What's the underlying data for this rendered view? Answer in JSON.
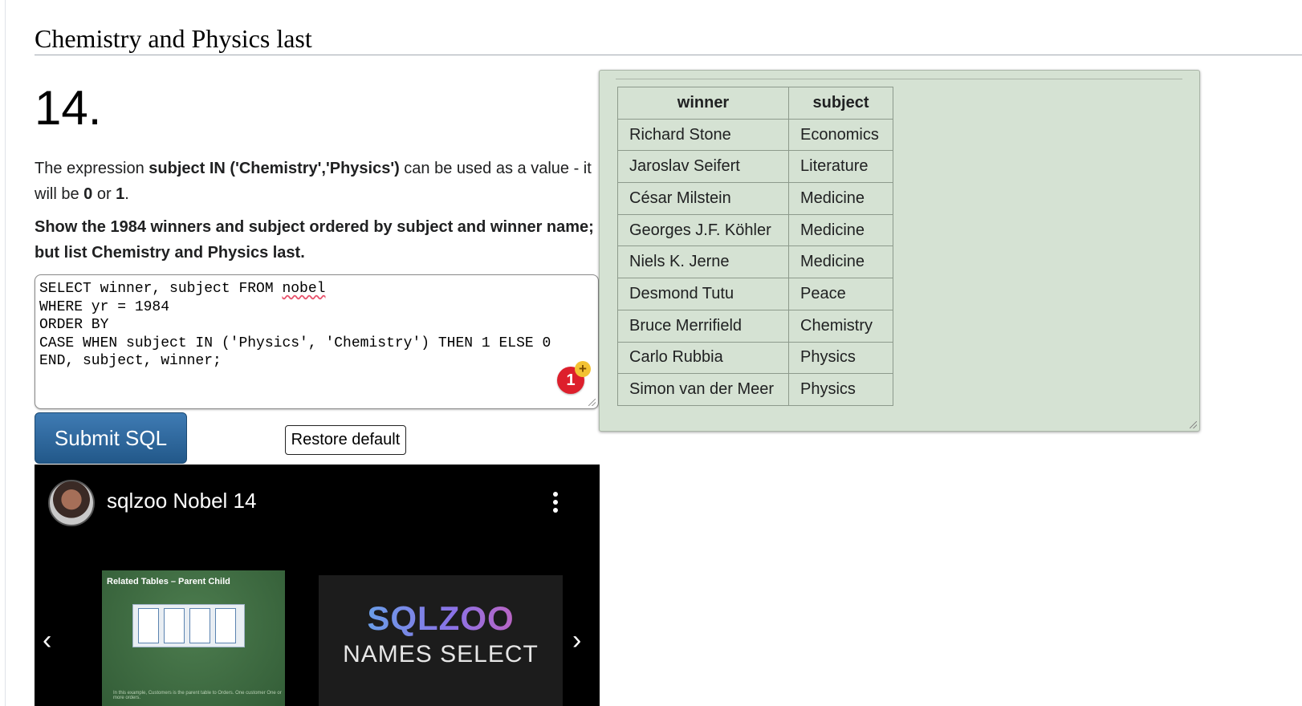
{
  "section": {
    "heading": "Chemistry and Physics last"
  },
  "question": {
    "number": "14.",
    "para1": {
      "t1": "The expression ",
      "b1": "subject IN ('Chemistry','Physics')",
      "t2": " can be used as a value - it will be ",
      "b2": "0",
      "t3": " or ",
      "b3": "1",
      "t4": "."
    },
    "task": "Show the 1984 winners and subject ordered by subject and winner name; but list Chemistry and Physics last."
  },
  "editor": {
    "line1_prefix": "SELECT winner, subject FROM ",
    "line1_table": "nobel",
    "line2": "WHERE yr = 1984",
    "line3": "ORDER BY",
    "line4": "CASE WHEN subject IN ('Physics', 'Chemistry') THEN 1 ELSE 0",
    "line5": "END, subject, winner;"
  },
  "badge": {
    "count": "1",
    "plus": "+"
  },
  "buttons": {
    "submit": "Submit SQL",
    "restore": "Restore default"
  },
  "video": {
    "title": "sqlzoo Nobel 14",
    "prev": "‹",
    "next": "›",
    "thumb1_title": "Related Tables – Parent Child",
    "thumb1_footer": "In this example, Customers is the parent table to Orders. One customer One or more orders.",
    "thumb2_brand": "SQLZOO",
    "thumb2_subtitle": "NAMES SELECT"
  },
  "results": {
    "headers": [
      "winner",
      "subject"
    ],
    "rows": [
      [
        "Richard Stone",
        "Economics"
      ],
      [
        "Jaroslav Seifert",
        "Literature"
      ],
      [
        "César Milstein",
        "Medicine"
      ],
      [
        "Georges J.F. Köhler",
        "Medicine"
      ],
      [
        "Niels K. Jerne",
        "Medicine"
      ],
      [
        "Desmond Tutu",
        "Peace"
      ],
      [
        "Bruce Merrifield",
        "Chemistry"
      ],
      [
        "Carlo Rubbia",
        "Physics"
      ],
      [
        "Simon van der Meer",
        "Physics"
      ]
    ]
  },
  "colors": {
    "result_panel_bg": "#d5e2d3",
    "submit_button": "#2f6aa0",
    "badge_red": "#dd1f2c",
    "badge_plus": "#f3c233"
  }
}
